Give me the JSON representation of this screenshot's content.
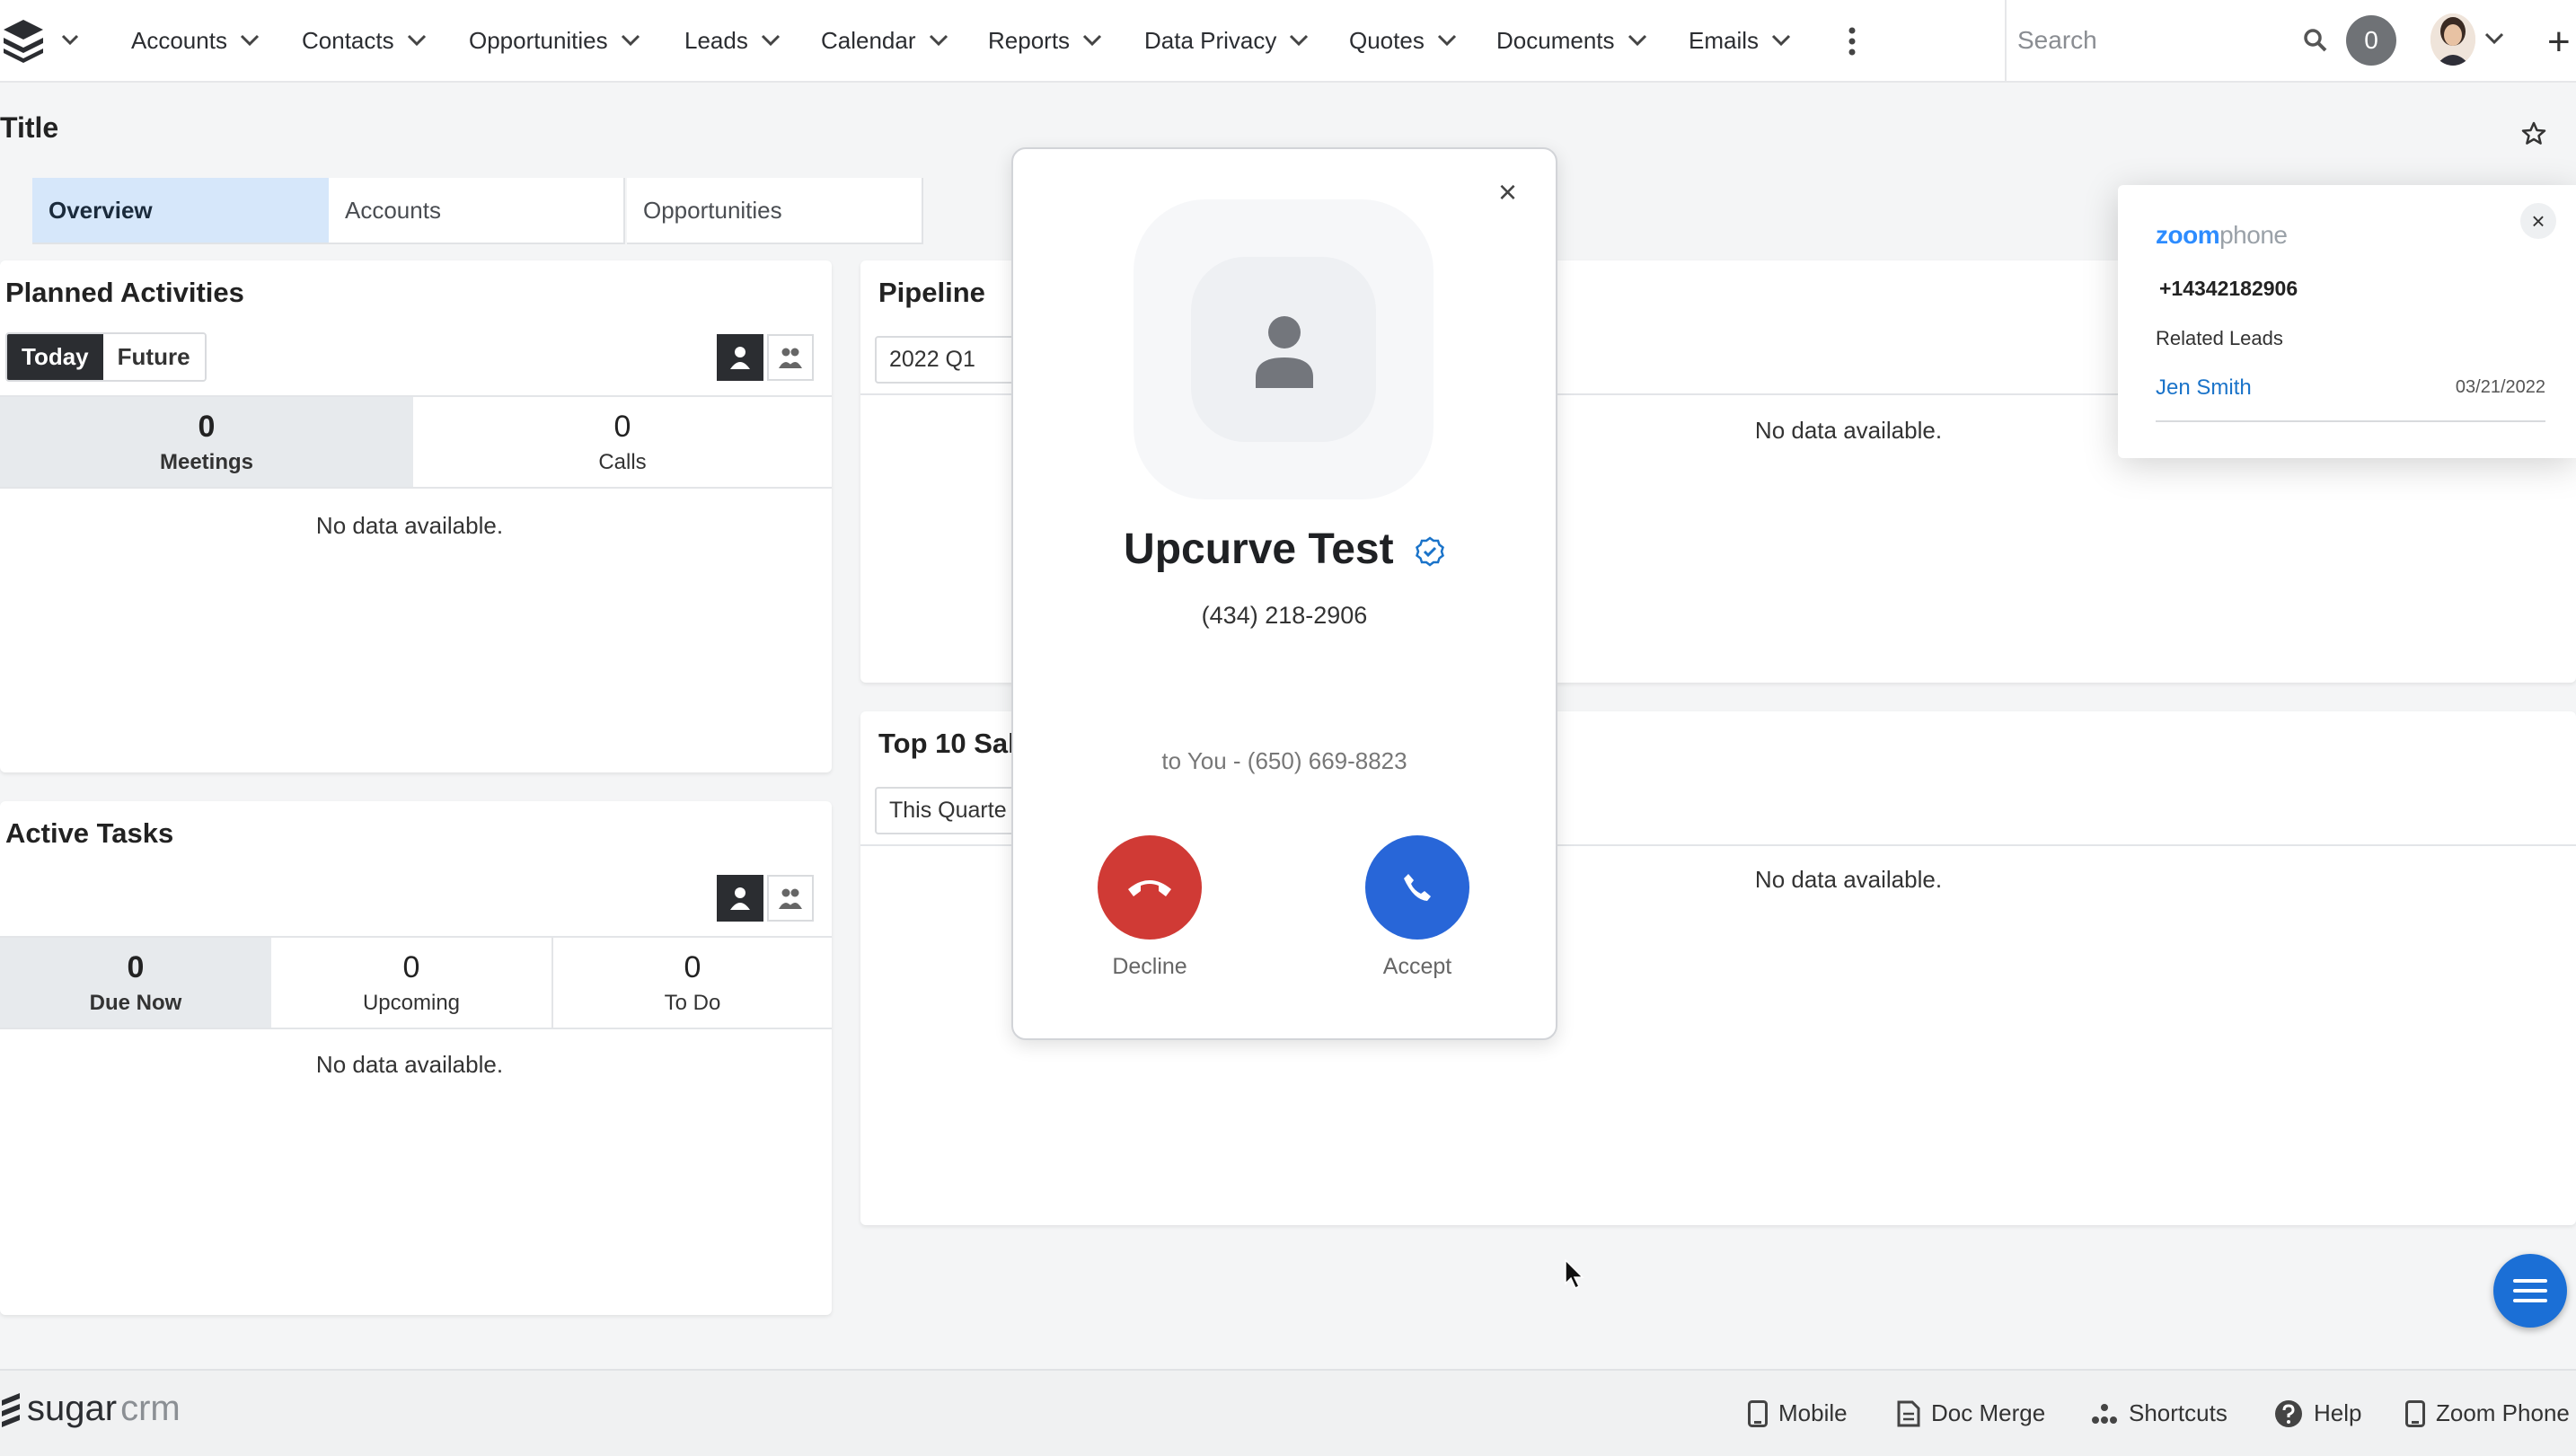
{
  "nav": {
    "items": [
      {
        "label": "Accounts"
      },
      {
        "label": "Contacts"
      },
      {
        "label": "Opportunities"
      },
      {
        "label": "Leads"
      },
      {
        "label": "Calendar"
      },
      {
        "label": "Reports"
      },
      {
        "label": "Data Privacy"
      },
      {
        "label": "Quotes"
      },
      {
        "label": "Documents"
      },
      {
        "label": "Emails"
      }
    ],
    "search_placeholder": "Search",
    "notification_count": "0",
    "plus_icon": "+"
  },
  "page": {
    "title": "Title",
    "tabs": [
      {
        "label": "Overview",
        "active": true
      },
      {
        "label": "Accounts"
      },
      {
        "label": "Opportunities"
      }
    ]
  },
  "planned_activities": {
    "title": "Planned Activities",
    "toggle": [
      "Today",
      "Future"
    ],
    "stats": [
      {
        "value": "0",
        "label": "Meetings"
      },
      {
        "value": "0",
        "label": "Calls"
      }
    ],
    "empty": "No data available."
  },
  "active_tasks": {
    "title": "Active Tasks",
    "stats": [
      {
        "value": "0",
        "label": "Due Now"
      },
      {
        "value": "0",
        "label": "Upcoming"
      },
      {
        "value": "0",
        "label": "To Do"
      }
    ],
    "empty": "No data available."
  },
  "pipeline": {
    "title": "Pipeline",
    "filter": "2022 Q1",
    "empty": "No data available."
  },
  "top_sales": {
    "title": "Top 10 Sal",
    "filter": "This Quarte",
    "empty": "No data available."
  },
  "call": {
    "caller_name": "Upcurve Test",
    "caller_number": "(434) 218-2906",
    "to_line": "to You - (650) 669-8823",
    "decline_label": "Decline",
    "accept_label": "Accept",
    "decline_color": "#d03a35",
    "accept_color": "#2866d8",
    "close_icon": "×"
  },
  "zoom": {
    "brand_zoom": "zoom",
    "brand_phone": "phone",
    "number": "+14342182906",
    "section": "Related Leads",
    "lead_name": "Jen Smith",
    "lead_date": "03/21/2022",
    "close_icon": "×"
  },
  "footer": {
    "brand_sugar": "sugar",
    "brand_crm": "crm",
    "items": [
      {
        "label": "Mobile"
      },
      {
        "label": "Doc Merge"
      },
      {
        "label": "Shortcuts"
      },
      {
        "label": "Help"
      },
      {
        "label": "Zoom Phone"
      }
    ]
  },
  "colors": {
    "accent_blue": "#1b6fd6",
    "link_blue": "#1a73c9",
    "active_tab": "#d6e7fa"
  }
}
